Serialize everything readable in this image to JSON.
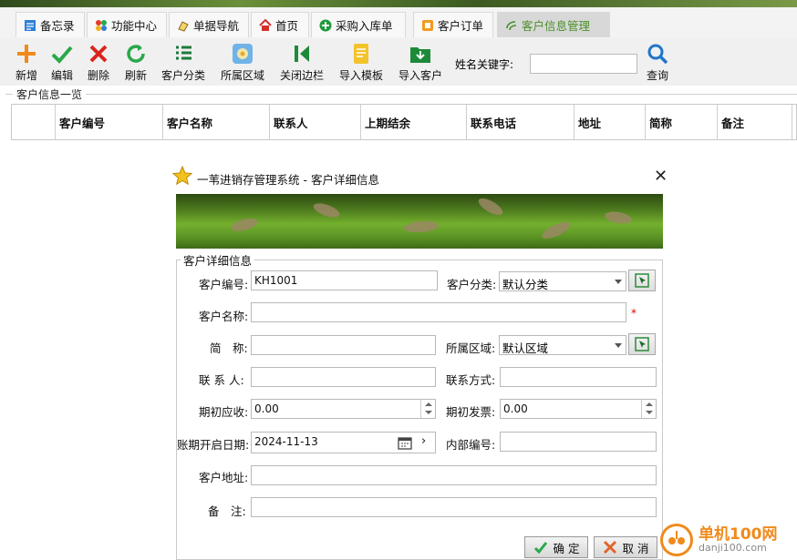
{
  "tabs": [
    {
      "label": "备忘录",
      "icon": "memo-icon"
    },
    {
      "label": "功能中心",
      "icon": "function-center-icon"
    },
    {
      "label": "单据导航",
      "icon": "document-nav-icon"
    },
    {
      "label": "首页",
      "icon": "home-icon"
    },
    {
      "label": "采购入库单",
      "icon": "purchase-icon"
    },
    {
      "label": "客户订单",
      "icon": "order-icon"
    },
    {
      "label": "客户信息管理",
      "icon": "customer-info-icon",
      "active": true
    }
  ],
  "toolbar": {
    "add": "新增",
    "edit": "编辑",
    "delete": "删除",
    "refresh": "刷新",
    "category": "客户分类",
    "region": "所属区域",
    "close_sidebar": "关闭边栏",
    "import_template": "导入模板",
    "import_customer": "导入客户",
    "keyword_label": "姓名关键字:",
    "keyword_value": "",
    "search": "查询"
  },
  "list": {
    "section_title": "客户信息一览",
    "columns": [
      "客户编号",
      "客户名称",
      "联系人",
      "上期结余",
      "联系电话",
      "地址",
      "简称",
      "备注"
    ]
  },
  "dialog": {
    "title": "一苇进销存管理系统 - 客户详细信息",
    "legend": "客户详细信息",
    "fields": {
      "code_label": "客户编号:",
      "code_value": "KH1001",
      "category_label": "客户分类:",
      "category_value": "默认分类",
      "name_label": "客户名称:",
      "name_value": "",
      "required_mark": "*",
      "short_label": "简　称:",
      "short_value": "",
      "region_label": "所属区域:",
      "region_value": "默认区域",
      "contact_label": "联 系 人:",
      "contact_value": "",
      "contact_method_label": "联系方式:",
      "contact_method_value": "",
      "receivable_label": "期初应收:",
      "receivable_value": "0.00",
      "invoice_label": "期初发票:",
      "invoice_value": "0.00",
      "start_date_label": "账期开启日期:",
      "start_date_value": "2024-11-13",
      "internal_code_label": "内部编号:",
      "internal_code_value": "",
      "address_label": "客户地址:",
      "address_value": "",
      "remark_label": "备　注:",
      "remark_value": ""
    },
    "ok": "确 定",
    "cancel": "取 消"
  },
  "watermark": {
    "brand": "单机100网",
    "url": "danji100.com"
  }
}
